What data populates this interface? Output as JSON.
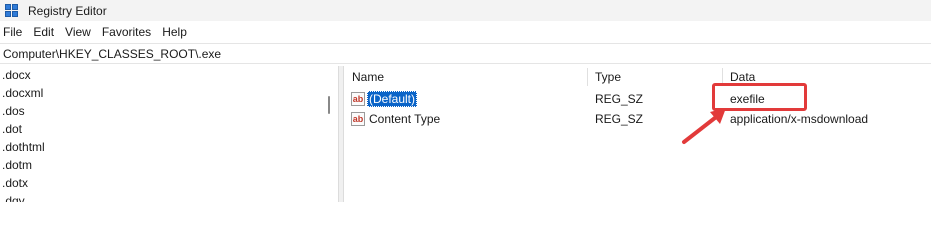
{
  "window": {
    "title": "Registry Editor"
  },
  "menu": [
    "File",
    "Edit",
    "View",
    "Favorites",
    "Help"
  ],
  "address": "Computer\\HKEY_CLASSES_ROOT\\.exe",
  "tree": [
    ".docx",
    ".docxml",
    ".dos",
    ".dot",
    ".dothtml",
    ".dotm",
    ".dotx",
    ".dqy"
  ],
  "columns": {
    "name": "Name",
    "type": "Type",
    "data": "Data"
  },
  "values": [
    {
      "name": "(Default)",
      "type": "REG_SZ",
      "data": "exefile",
      "selected": true,
      "icon": "string-value-icon"
    },
    {
      "name": "Content Type",
      "type": "REG_SZ",
      "data": "application/x-msdownload",
      "selected": false,
      "icon": "string-value-icon"
    }
  ],
  "icon_label": "ab",
  "annotation": {
    "color": "#e23a3a",
    "target": "exefile"
  },
  "colors": {
    "selection": "#0a64c8",
    "titlebar": "#f3f3f3"
  }
}
